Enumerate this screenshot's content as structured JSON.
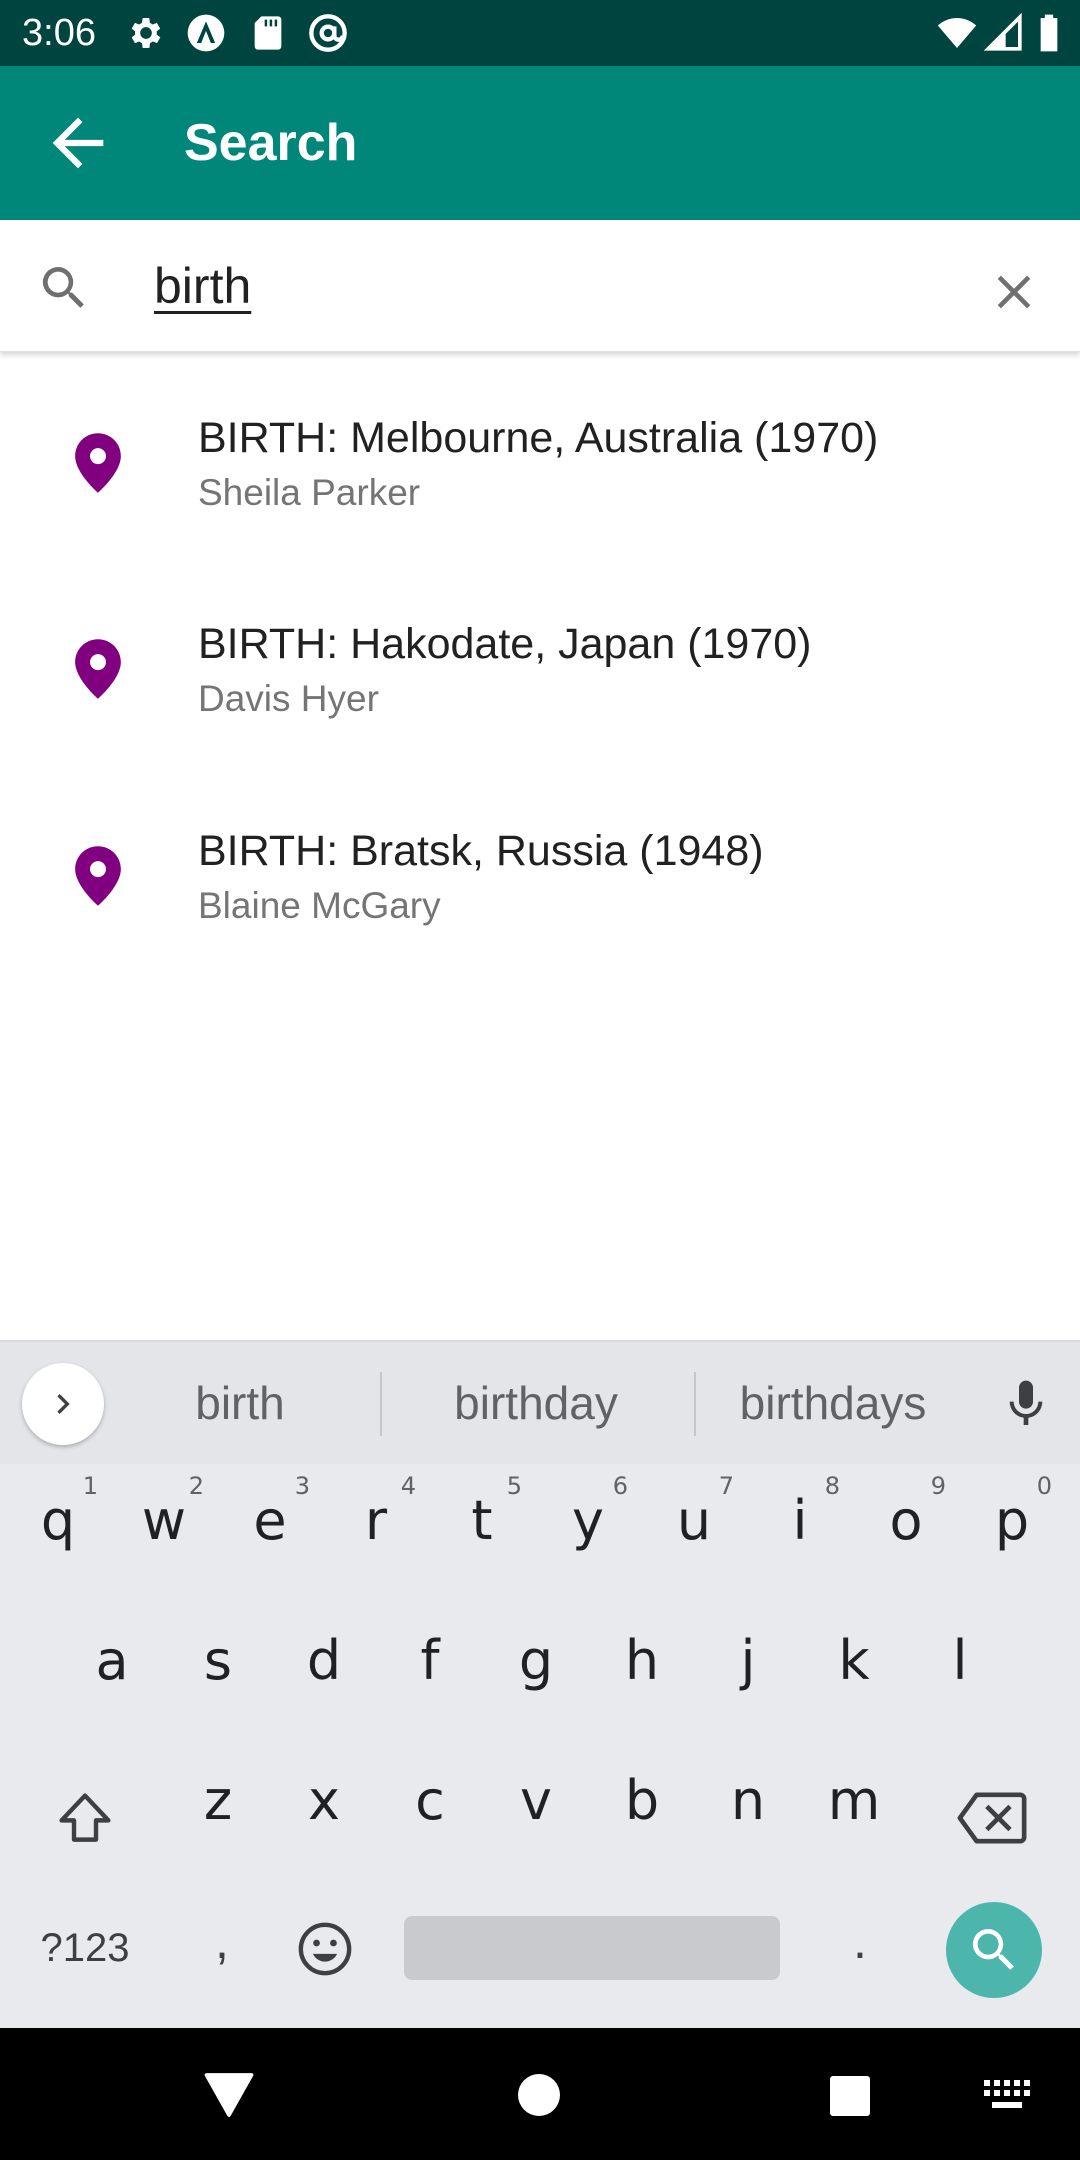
{
  "status_bar": {
    "time": "3:06",
    "left_icons": [
      "settings-icon",
      "a-logo-icon",
      "sd-card-icon",
      "at-sign-icon"
    ],
    "right_icons": [
      "wifi-icon",
      "signal-icon",
      "battery-icon"
    ]
  },
  "app_bar": {
    "title": "Search",
    "back_icon": "arrow-back-icon",
    "background": "#00877a"
  },
  "search": {
    "query": "birth",
    "search_icon": "search-icon",
    "clear_icon": "close-icon"
  },
  "results": [
    {
      "title": "BIRTH: Melbourne, Australia (1970)",
      "subtitle": "Sheila Parker",
      "icon": "location-pin-icon",
      "pin_color": "#800080"
    },
    {
      "title": "BIRTH: Hakodate, Japan (1970)",
      "subtitle": "Davis Hyer",
      "icon": "location-pin-icon",
      "pin_color": "#800080"
    },
    {
      "title": "BIRTH: Bratsk, Russia (1948)",
      "subtitle": "Blaine McGary",
      "icon": "location-pin-icon",
      "pin_color": "#800080"
    }
  ],
  "keyboard": {
    "suggestions": [
      "birth",
      "birthday",
      "birthdays"
    ],
    "row1": [
      {
        "k": "q",
        "h": "1"
      },
      {
        "k": "w",
        "h": "2"
      },
      {
        "k": "e",
        "h": "3"
      },
      {
        "k": "r",
        "h": "4"
      },
      {
        "k": "t",
        "h": "5"
      },
      {
        "k": "y",
        "h": "6"
      },
      {
        "k": "u",
        "h": "7"
      },
      {
        "k": "i",
        "h": "8"
      },
      {
        "k": "o",
        "h": "9"
      },
      {
        "k": "p",
        "h": "0"
      }
    ],
    "row2": [
      "a",
      "s",
      "d",
      "f",
      "g",
      "h",
      "j",
      "k",
      "l"
    ],
    "row3": [
      "z",
      "x",
      "c",
      "v",
      "b",
      "n",
      "m"
    ],
    "symbols_label": "?123",
    "comma_label": ",",
    "period_label": ".",
    "action_color": "#4db6ac"
  },
  "nav_bar": {
    "icons": [
      "nav-back-icon",
      "nav-home-icon",
      "nav-recents-icon",
      "keyboard-switch-icon"
    ]
  }
}
